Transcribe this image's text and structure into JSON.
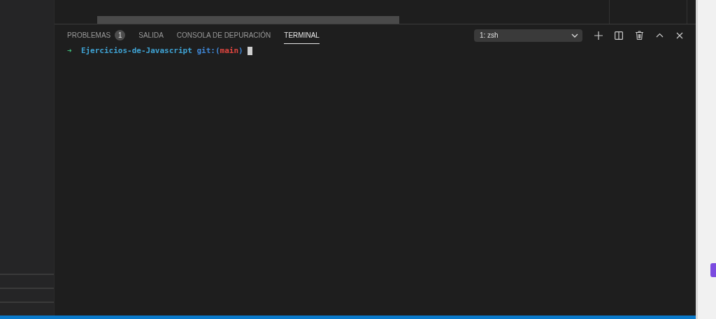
{
  "panel": {
    "tabs": [
      {
        "label": "PROBLEMAS",
        "badge": "1",
        "selected": false
      },
      {
        "label": "SALIDA",
        "selected": false
      },
      {
        "label": "CONSOLA DE DEPURACIÓN",
        "selected": false
      },
      {
        "label": "TERMINAL",
        "selected": true
      }
    ],
    "terminal_select": {
      "value": "1: zsh"
    },
    "terminal": {
      "prompt": {
        "arrow": "➜",
        "directory": "Ejercicios-de-Javascript",
        "git_open": "git:(",
        "branch": "main",
        "git_close": ")"
      }
    }
  }
}
